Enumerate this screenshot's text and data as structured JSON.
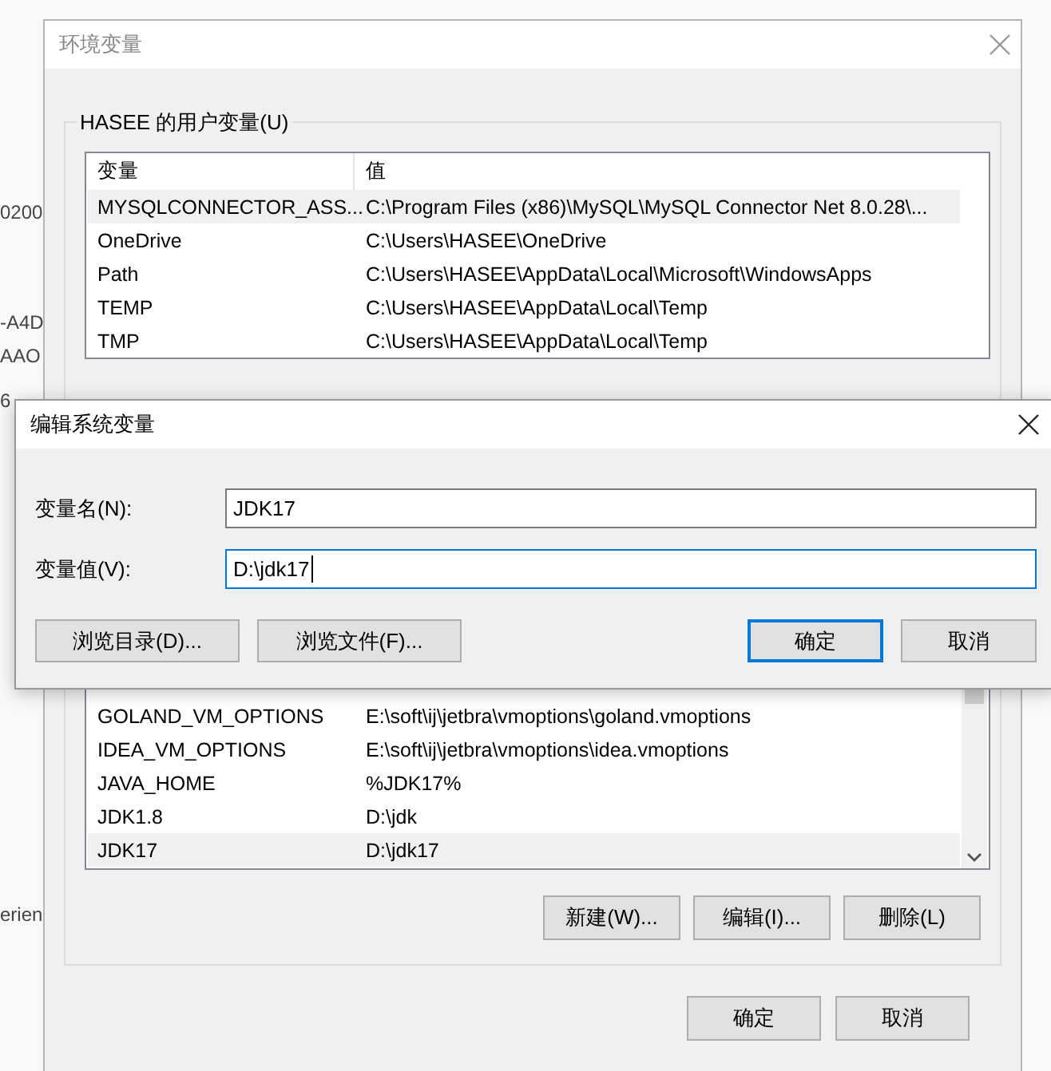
{
  "background_fragments": [
    "0200",
    "-A4D",
    "AAO",
    "6",
    "erien"
  ],
  "main_dialog": {
    "title": "环境变量",
    "user_group": {
      "label": "HASEE 的用户变量(U)",
      "columns": [
        "变量",
        "值"
      ],
      "rows": [
        {
          "name": "MYSQLCONNECTOR_ASS...",
          "value": "C:\\Program Files (x86)\\MySQL\\MySQL Connector Net 8.0.28\\...",
          "selected": true
        },
        {
          "name": "OneDrive",
          "value": "C:\\Users\\HASEE\\OneDrive",
          "selected": false
        },
        {
          "name": "Path",
          "value": "C:\\Users\\HASEE\\AppData\\Local\\Microsoft\\WindowsApps",
          "selected": false
        },
        {
          "name": "TEMP",
          "value": "C:\\Users\\HASEE\\AppData\\Local\\Temp",
          "selected": false
        },
        {
          "name": "TMP",
          "value": "C:\\Users\\HASEE\\AppData\\Local\\Temp",
          "selected": false
        }
      ]
    },
    "system_group": {
      "rows": [
        {
          "name": "GOLAND_VM_OPTIONS",
          "value": "E:\\soft\\ij\\jetbra\\vmoptions\\goland.vmoptions",
          "selected": false
        },
        {
          "name": "IDEA_VM_OPTIONS",
          "value": "E:\\soft\\ij\\jetbra\\vmoptions\\idea.vmoptions",
          "selected": false
        },
        {
          "name": "JAVA_HOME",
          "value": "%JDK17%",
          "selected": false
        },
        {
          "name": "JDK1.8",
          "value": "D:\\jdk",
          "selected": false
        },
        {
          "name": "JDK17",
          "value": "D:\\jdk17",
          "selected": true
        }
      ],
      "buttons": [
        "新建(W)...",
        "编辑(I)...",
        "删除(L)"
      ]
    },
    "buttons": [
      "确定",
      "取消"
    ]
  },
  "edit_dialog": {
    "title": "编辑系统变量",
    "fields": [
      {
        "label": "变量名(N):",
        "value": "JDK17",
        "focused": false
      },
      {
        "label": "变量值(V):",
        "value": "D:\\jdk17",
        "focused": true
      }
    ],
    "buttons": [
      {
        "label": "浏览目录(D)...",
        "default": false
      },
      {
        "label": "浏览文件(F)...",
        "default": false
      },
      {
        "label": "确定",
        "default": true
      },
      {
        "label": "取消",
        "default": false
      }
    ]
  }
}
